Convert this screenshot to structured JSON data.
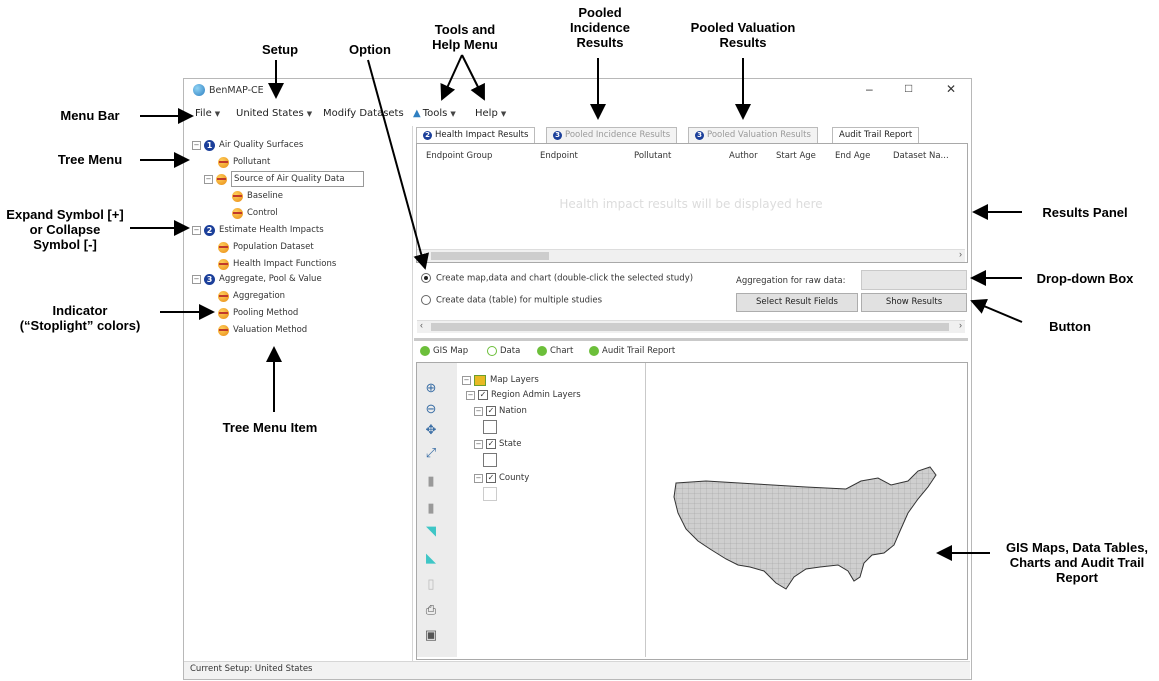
{
  "window": {
    "title": "BenMAP-CE",
    "status": "Current Setup: United States",
    "controls": {
      "minimize": "–",
      "maximize": "□",
      "close": "✕"
    }
  },
  "menu": {
    "file": "File",
    "setup": "United States",
    "modify": "Modify Datasets",
    "tools": "Tools",
    "help": "Help"
  },
  "tree": {
    "group1": "Air Quality Surfaces",
    "pollutant": "Pollutant",
    "source": "Source of Air Quality Data",
    "baseline": "Baseline",
    "control": "Control",
    "group2": "Estimate Health Impacts",
    "population": "Population Dataset",
    "hif": "Health Impact Functions",
    "group3": "Aggregate, Pool & Value",
    "aggregation": "Aggregation",
    "pooling": "Pooling Method",
    "valuation": "Valuation Method",
    "n1": "1",
    "n2": "2",
    "n3": "3"
  },
  "result_tabs": {
    "health": "Health Impact Results",
    "pooled_inc": "Pooled Incidence Results",
    "pooled_val": "Pooled Valuation Results",
    "audit": "Audit Trail Report"
  },
  "results_table": {
    "columns": [
      "Endpoint Group",
      "Endpoint",
      "Pollutant",
      "Author",
      "Start Age",
      "End Age",
      "Dataset Na..."
    ],
    "placeholder": "Health impact results will be displayed here"
  },
  "options": {
    "radio1": "Create map,data and chart (double-click the selected study)",
    "radio2": "Create data (table) for multiple studies",
    "aggregation_label": "Aggregation for raw data:",
    "aggregation_value": "",
    "select_fields": "Select Result Fields",
    "show_results": "Show Results"
  },
  "bottom_tabs": {
    "gis": "GIS Map",
    "data": "Data",
    "chart": "Chart",
    "audit": "Audit Trail Report"
  },
  "layers": {
    "root": "Map Layers",
    "region": "Region Admin Layers",
    "nation": "Nation",
    "state": "State",
    "county": "County"
  },
  "annotations": {
    "menu_bar": "Menu Bar",
    "tree_menu": "Tree Menu",
    "expand": "Expand Symbol [+]\nor Collapse\nSymbol [-]",
    "indicator": "Indicator\n(“Stoplight” colors)",
    "tree_item": "Tree Menu Item",
    "setup": "Setup",
    "option": "Option",
    "tools_help": "Tools and\nHelp Menu",
    "pooled_inc": "Pooled\nIncidence\nResults",
    "pooled_val": "Pooled Valuation\nResults",
    "results_panel": "Results Panel",
    "dropdown": "Drop-down Box",
    "button": "Button",
    "gis": "GIS Maps, Data Tables,\nCharts and Audit Trail\nReport"
  },
  "colors": {
    "step_badge": "#1b3f9a",
    "stoplight": "#f0a21e",
    "tab_icon_green": "#6cbf3a"
  }
}
